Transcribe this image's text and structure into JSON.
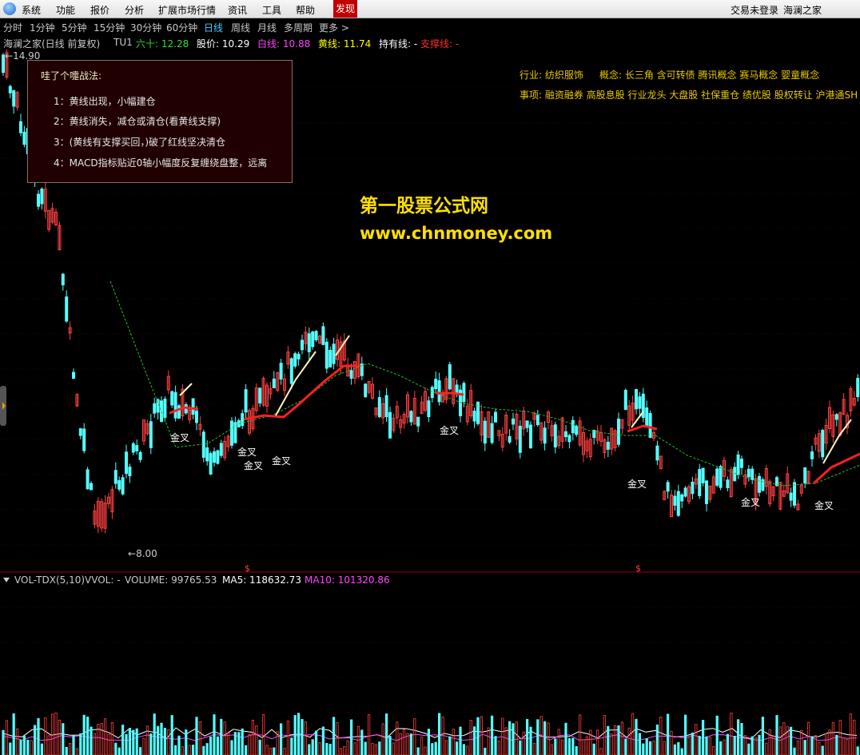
{
  "menubar": {
    "items": [
      "系统",
      "功能",
      "报价",
      "分析",
      "扩展市场行情",
      "资讯",
      "工具",
      "帮助",
      "发现"
    ],
    "login_status": "交易未登录",
    "site_name": "海澜之家"
  },
  "periods": [
    "分时",
    "1分钟",
    "5分钟",
    "15分钟",
    "30分钟",
    "60分钟",
    "日线",
    "周线",
    "月线",
    "多周期",
    "更多 >"
  ],
  "active_period": "日线",
  "info": {
    "stock": "海澜之家(日线 前复权)",
    "indicator": "TU1",
    "sixty": "六十: 12.28",
    "price": "股价: 10.29",
    "white": "白线: 10.88",
    "yellow": "黄线: 11.74",
    "hold": "持有线: -",
    "support": "支撑线: -"
  },
  "price_labels": {
    "high": "14.90",
    "low": "8.00"
  },
  "tooltip": {
    "title": "哇了个嚏战法:",
    "lines": [
      "1：黄线出现，小幅建仓",
      "2：黄线消失，减仓或清仓(看黄线支撑)",
      "3：(黄线有支撑买回，)破了红线坚决清仓",
      "4：MACD指标贴近0轴小幅度反复缠绕盘整，远离"
    ]
  },
  "tags": {
    "industry": "行业: 纺织服饰",
    "concept": "概念: 长三角 含可转债 腾讯概念 赛马概念 婴童概念",
    "events": "事项: 融资融券 高股息股 行业龙头 大盘股 社保重仓 绩优股 股权转让 沪港通SH"
  },
  "watermark": {
    "title": "第一股票公式网",
    "url": "www.chnmoney.com"
  },
  "signal_label": "金叉",
  "volume_line": {
    "name": "VOL-TDX(5,10)",
    "vvol": "VVOL: -",
    "volume": "VOLUME: 99765.53",
    "ma5": "MA5: 118632.73",
    "ma10": "MA10: 101320.86"
  },
  "colors": {
    "up": "#ff4040",
    "down": "#54ffff",
    "white_line": "#ffffff",
    "red_line": "#ff2020",
    "support_line": "#20c020",
    "tag_yellow": "#e8c800"
  }
}
